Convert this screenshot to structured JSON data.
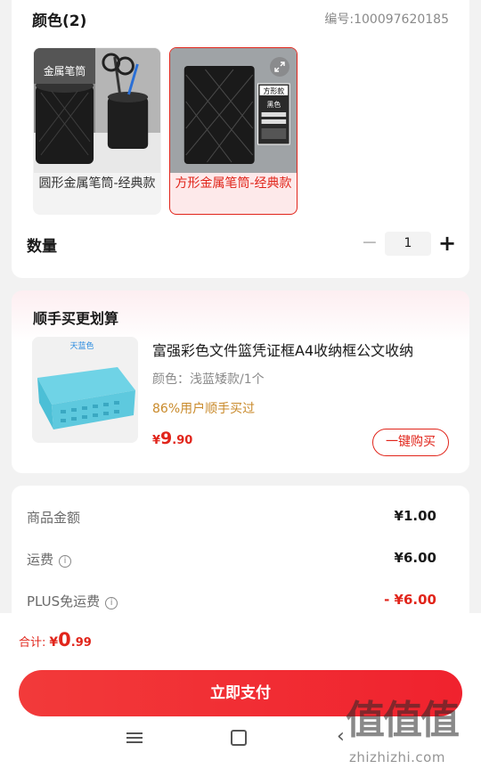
{
  "product_options": {
    "color_title": "颜色(2)",
    "sku": "编号:100097620185",
    "variants": [
      {
        "label": "圆形金属笔筒-经典款",
        "selected": false,
        "image_text": "金属笔筒"
      },
      {
        "label": "方形金属笔筒-经典款",
        "selected": true,
        "image_text": "方形款",
        "image_sub": "黑色"
      }
    ],
    "quantity_label": "数量",
    "quantity_value": "1",
    "minus_symbol": "−",
    "plus_symbol": "+"
  },
  "addon": {
    "title": "顺手买更划算",
    "image_text": "天蓝色",
    "name": "富强彩色文件篮凭证框A4收纳框公文收纳",
    "variant": "颜色：浅蓝矮款/1个",
    "rate": "86%用户顺手买过",
    "price_currency": "¥",
    "price_int": "9",
    "price_dec": ".90",
    "buy_label": "一键购买"
  },
  "summary": {
    "rows": [
      {
        "label": "商品金额",
        "value": "¥1.00",
        "info": false
      },
      {
        "label": "运费",
        "value": "¥6.00",
        "info": true
      },
      {
        "label": "PLUS免运费",
        "value": "- ¥6.00",
        "info": true,
        "red": true
      }
    ]
  },
  "bottom": {
    "total_label": "合计:",
    "total_currency": "¥",
    "total_int": "0",
    "total_dec": ".99",
    "pay_label": "立即支付"
  },
  "watermark": {
    "chars": "值值值",
    "url": "zhizhizhi.com"
  },
  "colors": {
    "accent": "#e1251b",
    "selected_bg": "#fde9ea",
    "rate_text": "#c98a2b"
  },
  "icons": [
    "expand-icon",
    "info-icon",
    "menu-nav-icon",
    "home-nav-icon",
    "back-nav-icon"
  ]
}
